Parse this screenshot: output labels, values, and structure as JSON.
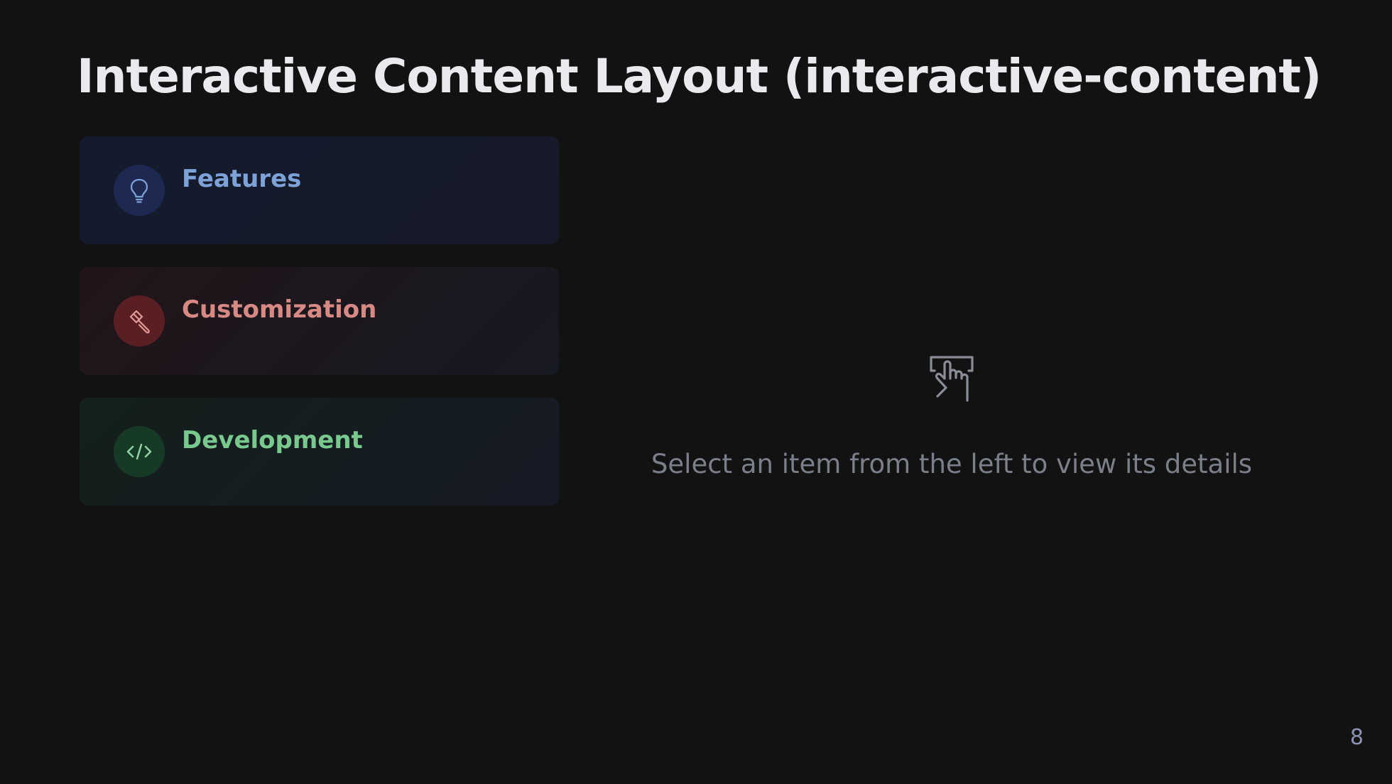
{
  "slide": {
    "title": "Interactive Content Layout (interactive-content)",
    "page_number": "8"
  },
  "items": [
    {
      "label": "Features",
      "icon": "lightbulb-icon",
      "color": "#7da2d8"
    },
    {
      "label": "Customization",
      "icon": "paintbrush-icon",
      "color": "#d78a84"
    },
    {
      "label": "Development",
      "icon": "code-icon",
      "color": "#79c98f"
    }
  ],
  "detail": {
    "icon": "hand-pointer-icon",
    "placeholder": "Select an item from the left to view its details"
  }
}
